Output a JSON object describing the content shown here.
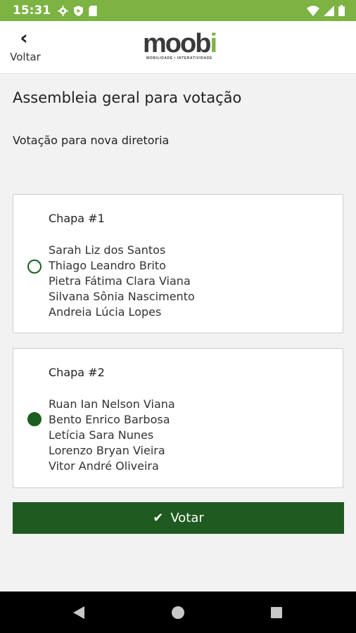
{
  "status_bar": {
    "time": "15:31",
    "left_icons": [
      "gear-icon",
      "shield-icon",
      "sd-card-icon"
    ],
    "right_icons": [
      "wifi-icon",
      "signal-icon",
      "battery-icon"
    ],
    "color": "#7cb342"
  },
  "app_bar": {
    "back_label": "Voltar",
    "logo_text_prefix": "moob",
    "logo_text_accent": "i",
    "logo_tagline": "MOBILIDADE • INTERATIVIDADE"
  },
  "page": {
    "title": "Assembleia geral para votação",
    "subtitle": "Votação para nova diretoria"
  },
  "options": [
    {
      "title": "Chapa #1",
      "selected": false,
      "members": [
        "Sarah Liz dos Santos",
        "Thiago Leandro Brito",
        "Pietra Fátima Clara Viana",
        "Silvana Sônia Nascimento",
        "Andreia Lúcia Lopes"
      ]
    },
    {
      "title": "Chapa #2",
      "selected": true,
      "members": [
        "Ruan Ian Nelson Viana",
        "Bento Enrico Barbosa",
        "Letícia Sara Nunes",
        "Lorenzo Bryan Vieira",
        "Vitor André Oliveira"
      ]
    }
  ],
  "vote_button": {
    "label": "Votar",
    "icon": "check-icon",
    "color": "#1f5a20"
  },
  "nav_bar": {
    "icons": [
      "back-triangle-icon",
      "home-circle-icon",
      "recents-square-icon"
    ]
  }
}
